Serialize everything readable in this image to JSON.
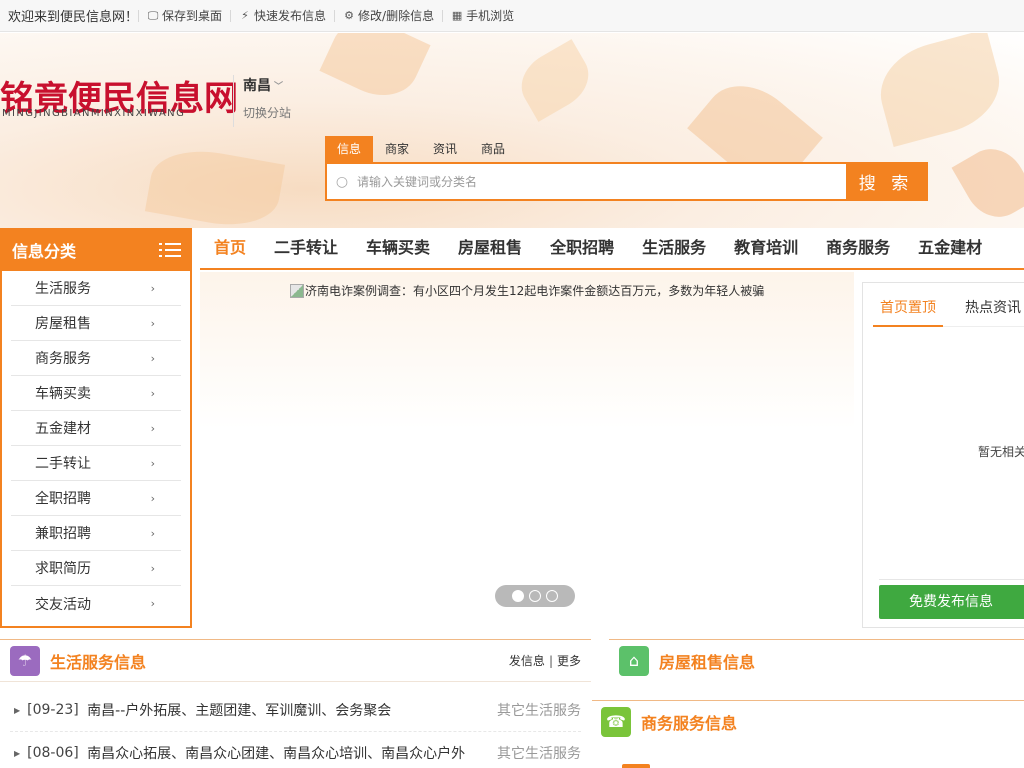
{
  "topbar": {
    "welcome": "欢迎来到便民信息网！",
    "links": [
      {
        "label": "保存到桌面",
        "icon": "monitor-icon"
      },
      {
        "label": "快速发布信息",
        "icon": "lightning-icon"
      },
      {
        "label": "修改/删除信息",
        "icon": "gear-icon"
      },
      {
        "label": "手机浏览",
        "icon": "qrcode-icon"
      }
    ]
  },
  "header": {
    "logo_cn": "铭竟便民信息网",
    "logo_en": "MINGJINGBIANMINXINXIWANG",
    "city": "南昌",
    "switch_city": "切换分站"
  },
  "search": {
    "tabs": [
      "信息",
      "商家",
      "资讯",
      "商品"
    ],
    "active_tab": "信息",
    "placeholder": "请输入关键词或分类名",
    "button": "搜 索"
  },
  "category": {
    "title": "信息分类",
    "items": [
      "生活服务",
      "房屋租售",
      "商务服务",
      "车辆买卖",
      "五金建材",
      "二手转让",
      "全职招聘",
      "兼职招聘",
      "求职简历",
      "交友活动"
    ]
  },
  "nav": {
    "items": [
      "首页",
      "二手转让",
      "车辆买卖",
      "房屋租售",
      "全职招聘",
      "生活服务",
      "教育培训",
      "商务服务",
      "五金建材"
    ],
    "active": "首页"
  },
  "banner": {
    "caption": "济南电诈案例调查：有小区四个月发生12起电诈案件金额达百万元，多数为年轻人被骗"
  },
  "right_panel": {
    "tabs": [
      "首页置顶",
      "热点资讯"
    ],
    "empty_text": "暂无相关",
    "publish_button": "免费发布信息"
  },
  "life_section": {
    "title": "生活服务信息",
    "post": "发信息",
    "more": "更多",
    "rows": [
      {
        "date": "[09-23]",
        "title": "南昌--户外拓展、主题团建、军训魔训、会务聚会",
        "category": "其它生活服务"
      },
      {
        "date": "[08-06]",
        "title": "南昌众心拓展、南昌众心团建、南昌众心培训、南昌众心户外",
        "category": "其它生活服务"
      }
    ]
  },
  "house_section": {
    "title": "房屋租售信息"
  },
  "business_section": {
    "title": "商务服务信息"
  },
  "colors": {
    "accent": "#f38220",
    "brand_red": "#c8102e",
    "green": "#3fa940",
    "purple_icon": "#9b6bbf",
    "green_icon": "#5cc16a",
    "lime_icon": "#7ac43a"
  }
}
